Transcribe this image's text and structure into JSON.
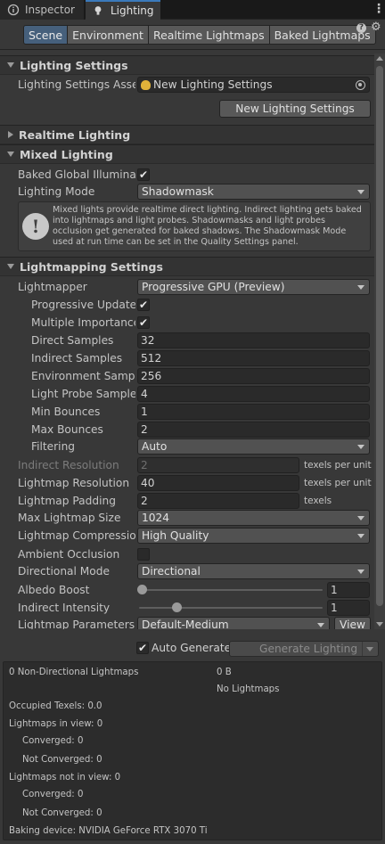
{
  "tabs": {
    "inspector": "Inspector",
    "lighting": "Lighting"
  },
  "modes": [
    "Scene",
    "Environment",
    "Realtime Lightmaps",
    "Baked Lightmaps"
  ],
  "active_mode": "Scene",
  "lighting_settings": {
    "header": "Lighting Settings",
    "asset_label": "Lighting Settings Asset",
    "asset_value": "New Lighting Settings",
    "new_button": "New Lighting Settings"
  },
  "realtime_lighting": {
    "header": "Realtime Lighting"
  },
  "mixed_lighting": {
    "header": "Mixed Lighting",
    "baked_gi_label": "Baked Global Illuminatio",
    "baked_gi_checked": true,
    "mode_label": "Lighting Mode",
    "mode_value": "Shadowmask",
    "help_text": "Mixed lights provide realtime direct lighting. Indirect lighting gets baked into lightmaps and light probes. Shadowmasks and light probes occlusion get generated for baked shadows. The Shadowmask Mode used at run time can be set in the Quality Settings panel."
  },
  "lightmapping": {
    "header": "Lightmapping Settings",
    "lightmapper_label": "Lightmapper",
    "lightmapper_value": "Progressive GPU (Preview)",
    "progressive_updates_label": "Progressive Updates",
    "progressive_updates_checked": true,
    "multiple_importance_label": "Multiple Importance S",
    "multiple_importance_checked": true,
    "direct_samples_label": "Direct Samples",
    "direct_samples": "32",
    "indirect_samples_label": "Indirect Samples",
    "indirect_samples": "512",
    "environment_samples_label": "Environment Samples",
    "environment_samples": "256",
    "light_probe_label": "Light Probe Sample M",
    "light_probe": "4",
    "min_bounces_label": "Min Bounces",
    "min_bounces": "1",
    "max_bounces_label": "Max Bounces",
    "max_bounces": "2",
    "filtering_label": "Filtering",
    "filtering_value": "Auto",
    "indirect_res_label": "Indirect Resolution",
    "indirect_res": "2",
    "indirect_res_unit": "texels per unit",
    "lightmap_res_label": "Lightmap Resolution",
    "lightmap_res": "40",
    "lightmap_res_unit": "texels per unit",
    "padding_label": "Lightmap Padding",
    "padding": "2",
    "padding_unit": "texels",
    "max_size_label": "Max Lightmap Size",
    "max_size_value": "1024",
    "compression_label": "Lightmap Compression",
    "compression_value": "High Quality",
    "ao_label": "Ambient Occlusion",
    "ao_checked": false,
    "directional_label": "Directional Mode",
    "directional_value": "Directional",
    "albedo_label": "Albedo Boost",
    "albedo_value": "1",
    "albedo_fraction": 0.0,
    "indirect_intensity_label": "Indirect Intensity",
    "indirect_intensity_value": "1",
    "indirect_intensity_fraction": 0.2,
    "params_label": "Lightmap Parameters",
    "params_value": "Default-Medium",
    "view_button": "View"
  },
  "generate": {
    "auto_label": "Auto Generate",
    "auto_checked": true,
    "button": "Generate Lighting"
  },
  "stats": {
    "non_directional": "0 Non-Directional Lightmaps",
    "size": "0 B",
    "no_lightmaps": "No Lightmaps",
    "occupied": "Occupied Texels: 0.0",
    "in_view": "Lightmaps in view: 0",
    "in_view_converged": "Converged: 0",
    "in_view_not_converged": "Not Converged: 0",
    "not_in_view": "Lightmaps not in view: 0",
    "not_in_view_converged": "Converged: 0",
    "not_in_view_not_converged": "Not Converged: 0",
    "device": "Baking device: NVIDIA GeForce RTX 3070 Ti"
  },
  "colors": {
    "accent": "#3a79bb",
    "active_mode": "#46607c",
    "panel": "#383838"
  }
}
